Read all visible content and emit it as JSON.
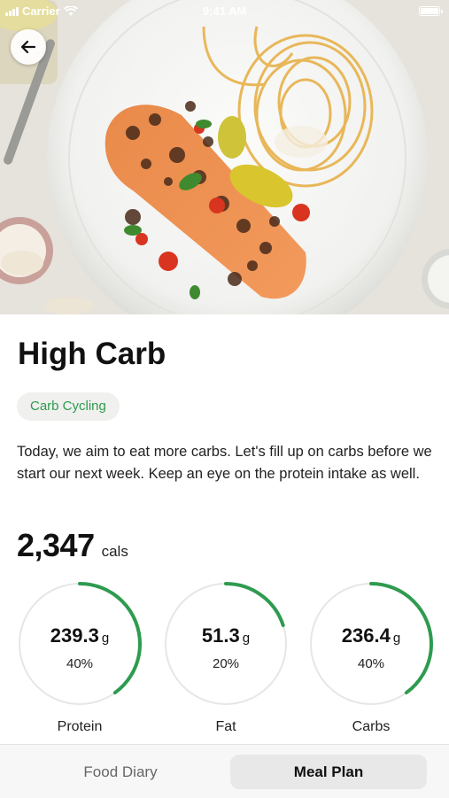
{
  "status_bar": {
    "carrier": "Carrier",
    "time": "9:41 AM"
  },
  "hero": {
    "image": "salmon-pasta-photo"
  },
  "header": {
    "title": "High Carb"
  },
  "tag": {
    "label": "Carb Cycling"
  },
  "description": "Today, we aim to eat more carbs. Let's fill up on carbs before we start our next week. Keep an eye on the protein intake as well.",
  "calories": {
    "value": "2,347",
    "unit": "cals"
  },
  "macros": [
    {
      "name": "Protein",
      "amount": "239.3",
      "unit": "g",
      "percent": "40%",
      "fraction": 0.4
    },
    {
      "name": "Fat",
      "amount": "51.3",
      "unit": "g",
      "percent": "20%",
      "fraction": 0.2
    },
    {
      "name": "Carbs",
      "amount": "236.4",
      "unit": "g",
      "percent": "40%",
      "fraction": 0.4
    }
  ],
  "tabs": [
    {
      "label": "Food Diary",
      "active": false
    },
    {
      "label": "Meal Plan",
      "active": true
    }
  ],
  "colors": {
    "accent": "#2e9b4f",
    "ring_track": "#e6e6e6"
  }
}
